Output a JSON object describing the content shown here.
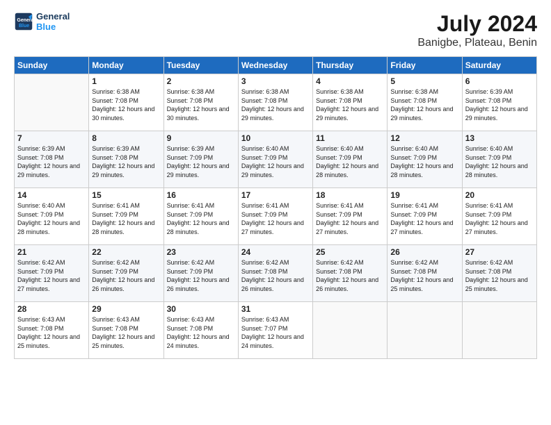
{
  "header": {
    "logo_line1": "General",
    "logo_line2": "Blue",
    "month": "July 2024",
    "location": "Banigbe, Plateau, Benin"
  },
  "weekdays": [
    "Sunday",
    "Monday",
    "Tuesday",
    "Wednesday",
    "Thursday",
    "Friday",
    "Saturday"
  ],
  "weeks": [
    [
      {
        "day": "",
        "sunrise": "",
        "sunset": "",
        "daylight": ""
      },
      {
        "day": "1",
        "sunrise": "Sunrise: 6:38 AM",
        "sunset": "Sunset: 7:08 PM",
        "daylight": "Daylight: 12 hours and 30 minutes."
      },
      {
        "day": "2",
        "sunrise": "Sunrise: 6:38 AM",
        "sunset": "Sunset: 7:08 PM",
        "daylight": "Daylight: 12 hours and 30 minutes."
      },
      {
        "day": "3",
        "sunrise": "Sunrise: 6:38 AM",
        "sunset": "Sunset: 7:08 PM",
        "daylight": "Daylight: 12 hours and 29 minutes."
      },
      {
        "day": "4",
        "sunrise": "Sunrise: 6:38 AM",
        "sunset": "Sunset: 7:08 PM",
        "daylight": "Daylight: 12 hours and 29 minutes."
      },
      {
        "day": "5",
        "sunrise": "Sunrise: 6:38 AM",
        "sunset": "Sunset: 7:08 PM",
        "daylight": "Daylight: 12 hours and 29 minutes."
      },
      {
        "day": "6",
        "sunrise": "Sunrise: 6:39 AM",
        "sunset": "Sunset: 7:08 PM",
        "daylight": "Daylight: 12 hours and 29 minutes."
      }
    ],
    [
      {
        "day": "7",
        "sunrise": "Sunrise: 6:39 AM",
        "sunset": "Sunset: 7:08 PM",
        "daylight": "Daylight: 12 hours and 29 minutes."
      },
      {
        "day": "8",
        "sunrise": "Sunrise: 6:39 AM",
        "sunset": "Sunset: 7:08 PM",
        "daylight": "Daylight: 12 hours and 29 minutes."
      },
      {
        "day": "9",
        "sunrise": "Sunrise: 6:39 AM",
        "sunset": "Sunset: 7:09 PM",
        "daylight": "Daylight: 12 hours and 29 minutes."
      },
      {
        "day": "10",
        "sunrise": "Sunrise: 6:40 AM",
        "sunset": "Sunset: 7:09 PM",
        "daylight": "Daylight: 12 hours and 29 minutes."
      },
      {
        "day": "11",
        "sunrise": "Sunrise: 6:40 AM",
        "sunset": "Sunset: 7:09 PM",
        "daylight": "Daylight: 12 hours and 28 minutes."
      },
      {
        "day": "12",
        "sunrise": "Sunrise: 6:40 AM",
        "sunset": "Sunset: 7:09 PM",
        "daylight": "Daylight: 12 hours and 28 minutes."
      },
      {
        "day": "13",
        "sunrise": "Sunrise: 6:40 AM",
        "sunset": "Sunset: 7:09 PM",
        "daylight": "Daylight: 12 hours and 28 minutes."
      }
    ],
    [
      {
        "day": "14",
        "sunrise": "Sunrise: 6:40 AM",
        "sunset": "Sunset: 7:09 PM",
        "daylight": "Daylight: 12 hours and 28 minutes."
      },
      {
        "day": "15",
        "sunrise": "Sunrise: 6:41 AM",
        "sunset": "Sunset: 7:09 PM",
        "daylight": "Daylight: 12 hours and 28 minutes."
      },
      {
        "day": "16",
        "sunrise": "Sunrise: 6:41 AM",
        "sunset": "Sunset: 7:09 PM",
        "daylight": "Daylight: 12 hours and 28 minutes."
      },
      {
        "day": "17",
        "sunrise": "Sunrise: 6:41 AM",
        "sunset": "Sunset: 7:09 PM",
        "daylight": "Daylight: 12 hours and 27 minutes."
      },
      {
        "day": "18",
        "sunrise": "Sunrise: 6:41 AM",
        "sunset": "Sunset: 7:09 PM",
        "daylight": "Daylight: 12 hours and 27 minutes."
      },
      {
        "day": "19",
        "sunrise": "Sunrise: 6:41 AM",
        "sunset": "Sunset: 7:09 PM",
        "daylight": "Daylight: 12 hours and 27 minutes."
      },
      {
        "day": "20",
        "sunrise": "Sunrise: 6:41 AM",
        "sunset": "Sunset: 7:09 PM",
        "daylight": "Daylight: 12 hours and 27 minutes."
      }
    ],
    [
      {
        "day": "21",
        "sunrise": "Sunrise: 6:42 AM",
        "sunset": "Sunset: 7:09 PM",
        "daylight": "Daylight: 12 hours and 27 minutes."
      },
      {
        "day": "22",
        "sunrise": "Sunrise: 6:42 AM",
        "sunset": "Sunset: 7:09 PM",
        "daylight": "Daylight: 12 hours and 26 minutes."
      },
      {
        "day": "23",
        "sunrise": "Sunrise: 6:42 AM",
        "sunset": "Sunset: 7:09 PM",
        "daylight": "Daylight: 12 hours and 26 minutes."
      },
      {
        "day": "24",
        "sunrise": "Sunrise: 6:42 AM",
        "sunset": "Sunset: 7:08 PM",
        "daylight": "Daylight: 12 hours and 26 minutes."
      },
      {
        "day": "25",
        "sunrise": "Sunrise: 6:42 AM",
        "sunset": "Sunset: 7:08 PM",
        "daylight": "Daylight: 12 hours and 26 minutes."
      },
      {
        "day": "26",
        "sunrise": "Sunrise: 6:42 AM",
        "sunset": "Sunset: 7:08 PM",
        "daylight": "Daylight: 12 hours and 25 minutes."
      },
      {
        "day": "27",
        "sunrise": "Sunrise: 6:42 AM",
        "sunset": "Sunset: 7:08 PM",
        "daylight": "Daylight: 12 hours and 25 minutes."
      }
    ],
    [
      {
        "day": "28",
        "sunrise": "Sunrise: 6:43 AM",
        "sunset": "Sunset: 7:08 PM",
        "daylight": "Daylight: 12 hours and 25 minutes."
      },
      {
        "day": "29",
        "sunrise": "Sunrise: 6:43 AM",
        "sunset": "Sunset: 7:08 PM",
        "daylight": "Daylight: 12 hours and 25 minutes."
      },
      {
        "day": "30",
        "sunrise": "Sunrise: 6:43 AM",
        "sunset": "Sunset: 7:08 PM",
        "daylight": "Daylight: 12 hours and 24 minutes."
      },
      {
        "day": "31",
        "sunrise": "Sunrise: 6:43 AM",
        "sunset": "Sunset: 7:07 PM",
        "daylight": "Daylight: 12 hours and 24 minutes."
      },
      {
        "day": "",
        "sunrise": "",
        "sunset": "",
        "daylight": ""
      },
      {
        "day": "",
        "sunrise": "",
        "sunset": "",
        "daylight": ""
      },
      {
        "day": "",
        "sunrise": "",
        "sunset": "",
        "daylight": ""
      }
    ]
  ]
}
